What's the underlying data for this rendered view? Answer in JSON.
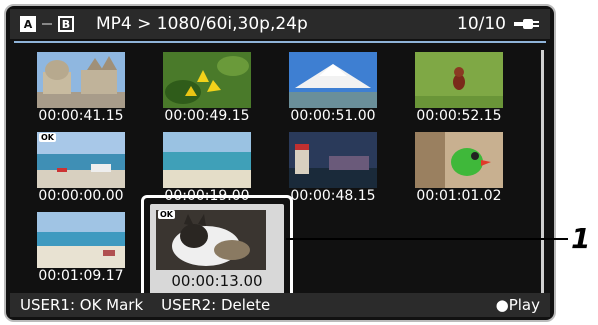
{
  "topbar": {
    "slot_a": "A",
    "slot_b": "B",
    "format": "MP4 > 1080/60i,30p,24p",
    "count": "10/10"
  },
  "thumbnails": [
    {
      "time": "00:00:41.15",
      "ok": false
    },
    {
      "time": "00:00:49.15",
      "ok": false
    },
    {
      "time": "00:00:51.00",
      "ok": false
    },
    {
      "time": "00:00:52.15",
      "ok": false
    },
    {
      "time": "00:00:00.00",
      "ok": true
    },
    {
      "time": "00:00:19.00",
      "ok": false
    },
    {
      "time": "00:00:48.15",
      "ok": false
    },
    {
      "time": "00:01:01.02",
      "ok": false
    },
    {
      "time": "00:01:09.17",
      "ok": false
    }
  ],
  "selected": {
    "time": "00:00:13.00",
    "ok": true,
    "ok_label": "OK"
  },
  "ok_label": "OK",
  "bottombar": {
    "user1": "USER1: OK Mark",
    "user2": "USER2: Delete",
    "play": "●Play"
  },
  "callout": "1",
  "icons": {
    "battery": "battery-plug-icon",
    "slot_a": "card-slot-a-icon",
    "slot_b": "card-slot-b-icon"
  }
}
